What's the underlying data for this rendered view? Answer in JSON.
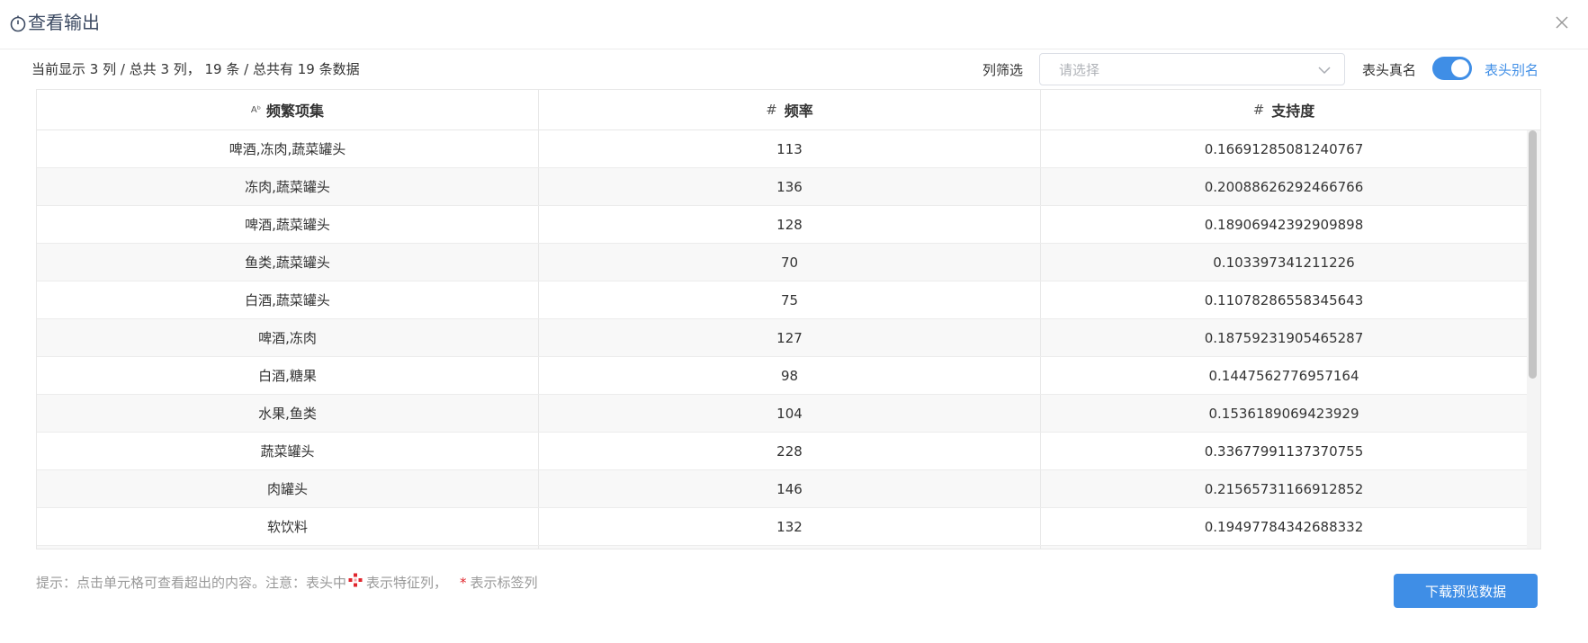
{
  "dialog": {
    "title": "查看输出",
    "icons": {
      "title": "timer-icon",
      "close": "close-icon"
    }
  },
  "toolbar": {
    "info": "当前显示 3 列 / 总共 3 列， 19 条 / 总共有 19 条数据",
    "filter_label": "列筛选",
    "filter_placeholder": "请选择",
    "realname_label": "表头真名",
    "switch_on": true,
    "alias_label": "表头别名"
  },
  "table": {
    "columns": [
      {
        "type_icon": "Aᵇ",
        "label": "频繁项集"
      },
      {
        "type_icon": "#",
        "label": "频率"
      },
      {
        "type_icon": "#",
        "label": "支持度"
      }
    ],
    "rows": [
      [
        "啤酒,冻肉,蔬菜罐头",
        "113",
        "0.16691285081240767"
      ],
      [
        "冻肉,蔬菜罐头",
        "136",
        "0.20088626292466766"
      ],
      [
        "啤酒,蔬菜罐头",
        "128",
        "0.18906942392909898"
      ],
      [
        "鱼类,蔬菜罐头",
        "70",
        "0.103397341211226"
      ],
      [
        "白酒,蔬菜罐头",
        "75",
        "0.11078286558345643"
      ],
      [
        "啤酒,冻肉",
        "127",
        "0.18759231905465287"
      ],
      [
        "白酒,糖果",
        "98",
        "0.1447562776957164"
      ],
      [
        "水果,鱼类",
        "104",
        "0.1536189069423929"
      ],
      [
        "蔬菜罐头",
        "228",
        "0.33677991137370755"
      ],
      [
        "肉罐头",
        "146",
        "0.21565731166912852"
      ],
      [
        "软饮料",
        "132",
        "0.19497784342688332"
      ],
      [
        "",
        "",
        ""
      ]
    ]
  },
  "footer": {
    "hint_prefix": "提示：点击单元格可查看超出的内容。注意：表头中",
    "hint_feature": "表示特征列，",
    "hint_star": "*",
    "hint_label": "表示标签列",
    "download_label": "下载预览数据"
  },
  "colors": {
    "accent": "#3f8ee6",
    "label_star": "#e0262d"
  }
}
